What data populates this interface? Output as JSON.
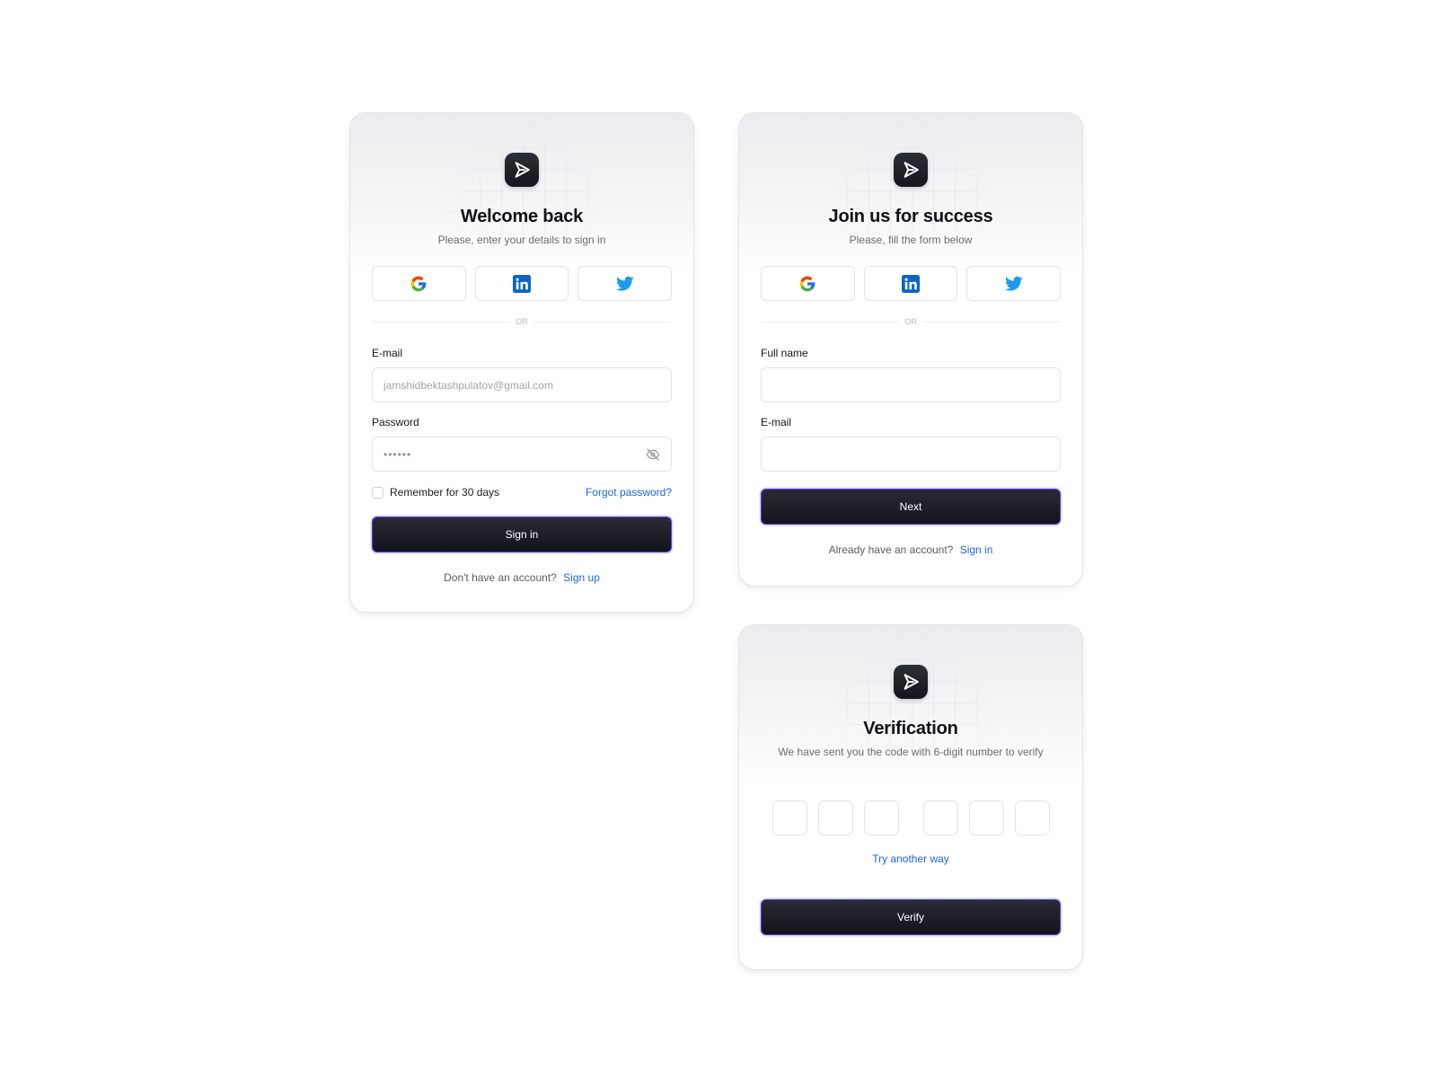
{
  "icons": {
    "logo": "send-arrow-icon",
    "google": "google-icon",
    "linkedin": "linkedin-icon",
    "twitter": "twitter-icon",
    "eye_off": "eye-off-icon"
  },
  "colors": {
    "accent_link": "#1e64e6",
    "primary_button": "#1b1b24",
    "primary_button_border": "#4a43e0",
    "card_border": "#e3e3e8"
  },
  "signin": {
    "title": "Welcome back",
    "subtitle": "Please, enter your details to sign in",
    "divider": "OR",
    "email_label": "E-mail",
    "email_placeholder": "jamshidbektashpulatov@gmail.com",
    "password_label": "Password",
    "password_value": "••••••",
    "remember_label": "Remember for 30 days",
    "forgot_link": "Forgot password?",
    "submit_label": "Sign in",
    "footer_text": "Don't have an account?",
    "footer_link": "Sign up"
  },
  "signup": {
    "title": "Join us for success",
    "subtitle": "Please, fill the form below",
    "divider": "OR",
    "fullname_label": "Full name",
    "fullname_value": "",
    "email_label": "E-mail",
    "email_value": "",
    "submit_label": "Next",
    "footer_text": "Already have an account?",
    "footer_link": "Sign in"
  },
  "verify": {
    "title": "Verification",
    "subtitle": "We have sent you the code with 6-digit number to verify",
    "alt_link": "Try another way",
    "submit_label": "Verify"
  }
}
